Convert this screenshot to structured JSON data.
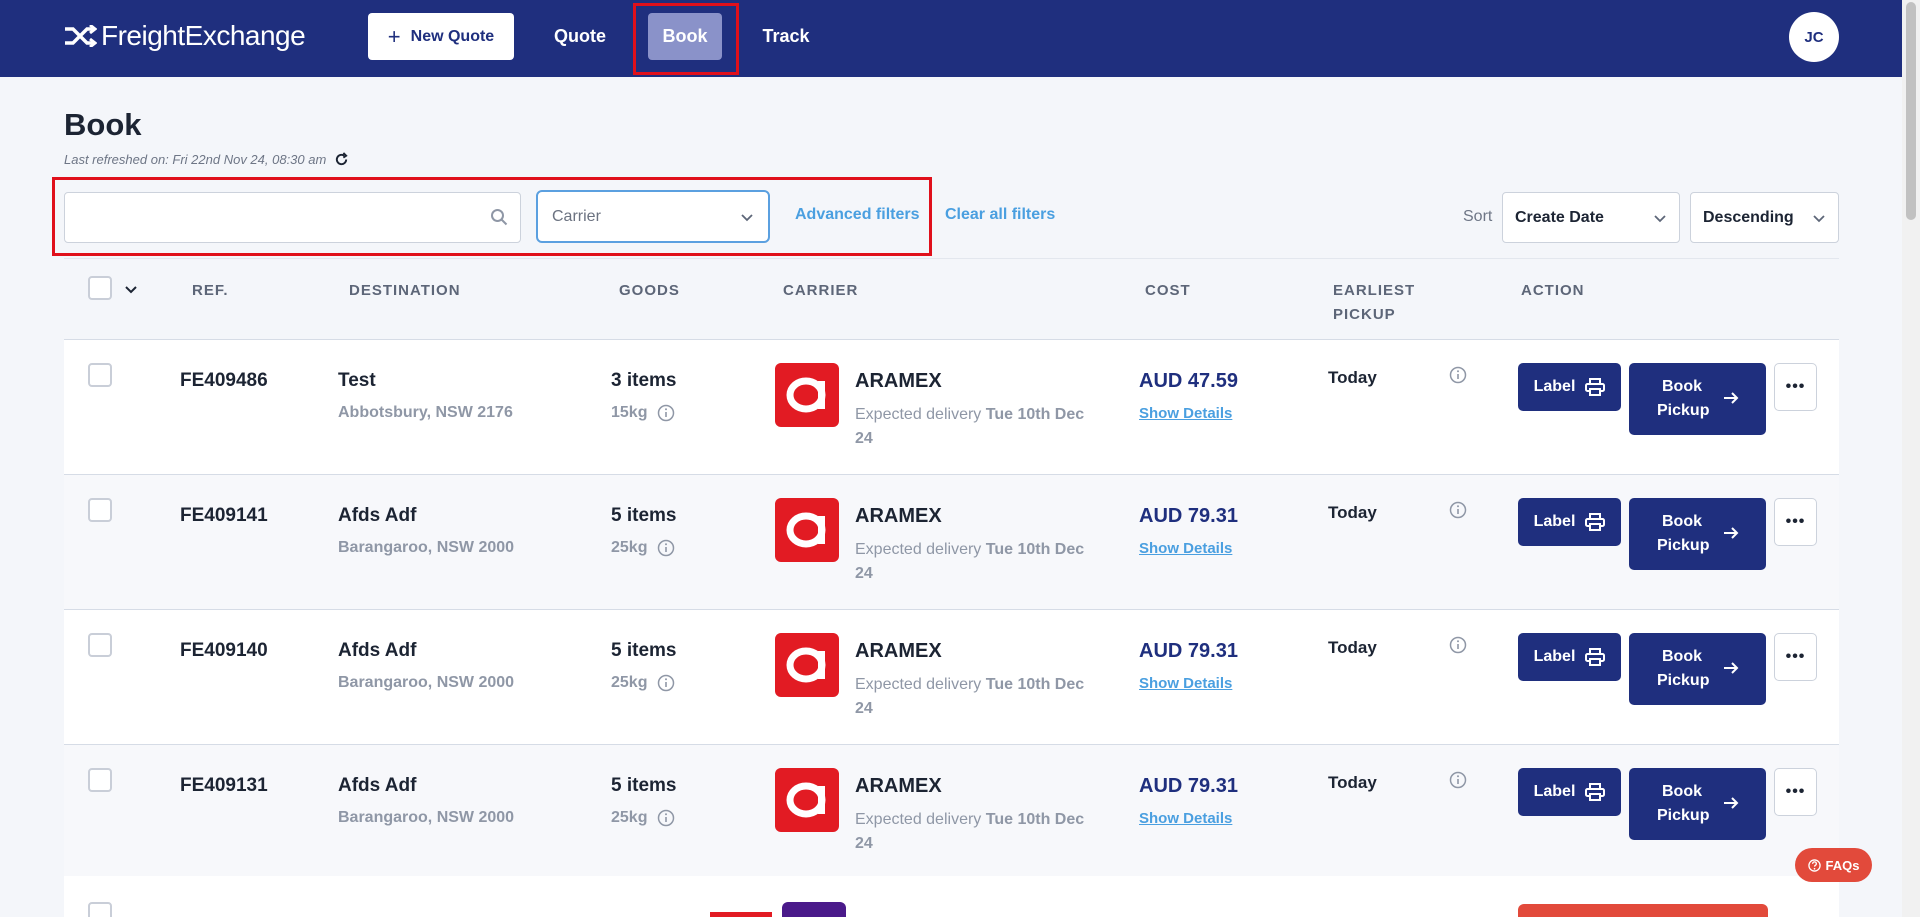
{
  "nav": {
    "brand": "FreightExchange",
    "new_quote": "New Quote",
    "quote": "Quote",
    "book": "Book",
    "track": "Track",
    "avatar": "JC"
  },
  "header": {
    "title": "Book",
    "last_refreshed": "Last refreshed on: Fri 22nd Nov 24, 08:30 am"
  },
  "filters": {
    "search_value": "",
    "carrier_placeholder": "Carrier",
    "advanced": "Advanced filters",
    "clear": "Clear all filters",
    "sort_label": "Sort",
    "sort_field": "Create Date",
    "sort_order": "Descending"
  },
  "table": {
    "columns": [
      "REF.",
      "DESTINATION",
      "GOODS",
      "CARRIER",
      "COST",
      "EARLIEST PICKUP",
      "ACTION"
    ],
    "rows": [
      {
        "ref": "FE409486",
        "dest_name": "Test",
        "dest_addr": "Abbotsbury, NSW 2176",
        "items": "3 items",
        "weight": "15kg",
        "carrier": "ARAMEX",
        "exp_prefix": "Expected delivery",
        "exp_date": "Tue 10th Dec 24",
        "cost": "AUD 47.59",
        "details": "Show Details",
        "pickup": "Today",
        "label_btn": "Label",
        "pickup_btn": "Book Pickup"
      },
      {
        "ref": "FE409141",
        "dest_name": "Afds Adf",
        "dest_addr": "Barangaroo, NSW 2000",
        "items": "5 items",
        "weight": "25kg",
        "carrier": "ARAMEX",
        "exp_prefix": "Expected delivery",
        "exp_date": "Tue 10th Dec 24",
        "cost": "AUD 79.31",
        "details": "Show Details",
        "pickup": "Today",
        "label_btn": "Label",
        "pickup_btn": "Book Pickup"
      },
      {
        "ref": "FE409140",
        "dest_name": "Afds Adf",
        "dest_addr": "Barangaroo, NSW 2000",
        "items": "5 items",
        "weight": "25kg",
        "carrier": "ARAMEX",
        "exp_prefix": "Expected delivery",
        "exp_date": "Tue 10th Dec 24",
        "cost": "AUD 79.31",
        "details": "Show Details",
        "pickup": "Today",
        "label_btn": "Label",
        "pickup_btn": "Book Pickup"
      },
      {
        "ref": "FE409131",
        "dest_name": "Afds Adf",
        "dest_addr": "Barangaroo, NSW 2000",
        "items": "5 items",
        "weight": "25kg",
        "carrier": "ARAMEX",
        "exp_prefix": "Expected delivery",
        "exp_date": "Tue 10th Dec 24",
        "cost": "AUD 79.31",
        "details": "Show Details",
        "pickup": "Today",
        "label_btn": "Label",
        "pickup_btn": "Book Pickup"
      }
    ]
  },
  "faq": "FAQs",
  "colors": {
    "nav_bg": "#1f2f7e",
    "accent_link": "#4a9fe0",
    "aramex_red": "#e21b23",
    "highlight": "#e0101b"
  },
  "icons": [
    "shuffle-logo-icon",
    "plus-icon",
    "refresh-icon",
    "search-icon",
    "chevron-down-icon",
    "info-icon",
    "printer-icon",
    "arrow-right-icon",
    "more-icon",
    "help-icon"
  ]
}
